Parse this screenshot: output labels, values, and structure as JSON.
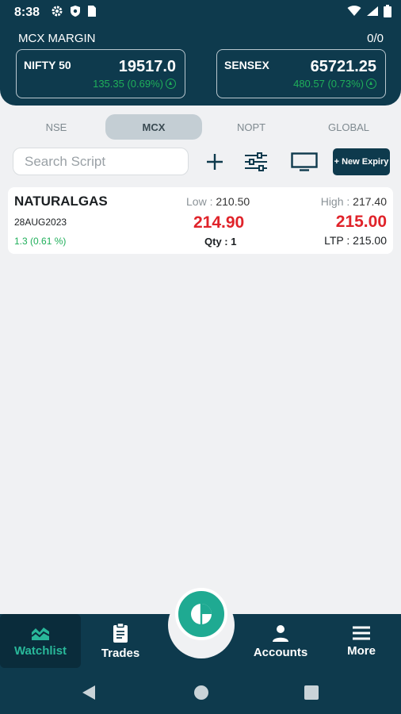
{
  "status_bar": {
    "time": "8:38"
  },
  "header": {
    "margin_title": "MCX MARGIN",
    "margin_value": "0/0",
    "indices": [
      {
        "name": "NIFTY 50",
        "price": "19517.0",
        "change": "135.35 (0.69%)"
      },
      {
        "name": "SENSEX",
        "price": "65721.25",
        "change": "480.57 (0.73%)"
      }
    ]
  },
  "tabs": [
    {
      "label": "NSE"
    },
    {
      "label": "MCX",
      "active": true
    },
    {
      "label": "NOPT"
    },
    {
      "label": "GLOBAL"
    }
  ],
  "toolbar": {
    "search_placeholder": "Search Script",
    "new_expiry_label": "+ New Expiry"
  },
  "watchlist": [
    {
      "symbol": "NATURALGAS",
      "expiry": "28AUG2023",
      "change": "1.3 (0.61 %)",
      "low_label": "Low :",
      "low_value": "210.50",
      "high_label": "High :",
      "high_value": "217.40",
      "bid": "214.90",
      "ask": "215.00",
      "qty_label": "Qty :",
      "qty_value": "1",
      "ltp_label": "LTP :",
      "ltp_value": "215.00"
    }
  ],
  "bottom_nav": {
    "watchlist": "Watchlist",
    "trades": "Trades",
    "accounts": "Accounts",
    "more": "More"
  },
  "colors": {
    "primary": "#0e3a4d",
    "accent": "#1faa92",
    "positive": "#1faf5a",
    "price_red": "#e0232a"
  }
}
